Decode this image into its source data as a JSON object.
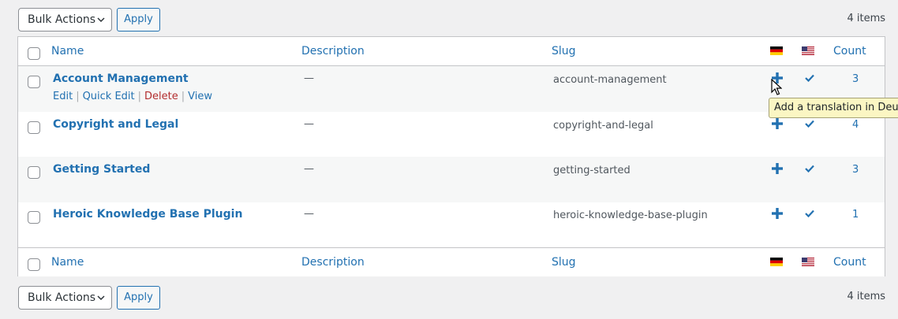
{
  "top_nav": {
    "bulk_actions_label": "Bulk Actions",
    "apply_label": "Apply",
    "items_count": "4 items"
  },
  "bottom_nav": {
    "bulk_actions_label": "Bulk Actions",
    "apply_label": "Apply",
    "items_count": "4 items"
  },
  "columns": {
    "name": "Name",
    "description": "Description",
    "slug": "Slug",
    "count": "Count",
    "flag_de": "german-flag-icon",
    "flag_us": "us-flag-icon"
  },
  "rows": [
    {
      "name": "Account Management",
      "description": "—",
      "slug": "account-management",
      "count": "3",
      "actions": {
        "edit": "Edit",
        "quick_edit": "Quick Edit",
        "delete": "Delete",
        "view": "View"
      }
    },
    {
      "name": "Copyright and Legal",
      "description": "—",
      "slug": "copyright-and-legal",
      "count": "4"
    },
    {
      "name": "Getting Started",
      "description": "—",
      "slug": "getting-started",
      "count": "3"
    },
    {
      "name": "Heroic Knowledge Base Plugin",
      "description": "—",
      "slug": "heroic-knowledge-base-plugin",
      "count": "1"
    }
  ],
  "tooltip": "Add a translation in Deutsch",
  "colors": {
    "link": "#2271b1",
    "delete": "#b32d2e",
    "border": "#c3c4c7",
    "background": "#f0f0f1",
    "alt_row": "#f6f7f7",
    "tooltip_bg": "#fbf6c3"
  }
}
